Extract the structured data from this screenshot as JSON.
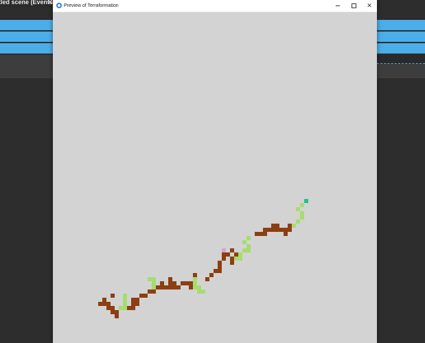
{
  "background_app": {
    "tab_label": "tled scene (Events)",
    "tab_close_glyph": "✕",
    "accent_color": "#4baee8"
  },
  "window": {
    "title": "Preview of Terraformation",
    "icon": "app-logo-icon",
    "controls": {
      "minimize_icon": "minimize-icon",
      "maximize_icon": "maximize-icon",
      "close_glyph": "✕"
    }
  },
  "terrain": {
    "background_color": "#d3d3d3",
    "colors": {
      "dirt": "#8b3f12",
      "grass": "#a6dd6e",
      "flower": "#e0a0d0",
      "gem": "#22c38a"
    }
  }
}
